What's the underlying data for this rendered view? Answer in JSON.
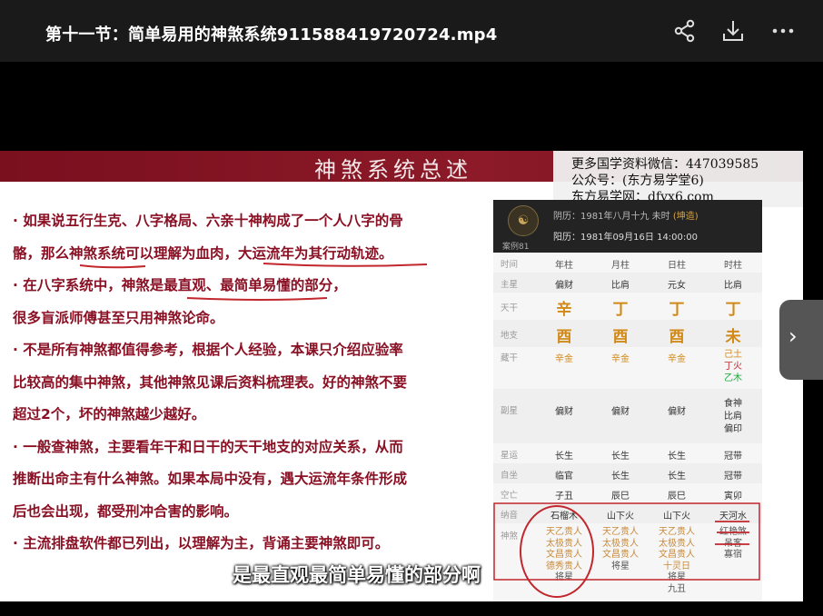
{
  "window": {
    "title": "第十一节：简单易用的神煞系统911588419720724.mp4",
    "icons": [
      "share-icon",
      "download-icon",
      "more-icon"
    ]
  },
  "slide": {
    "banner_title": "神煞系统总述",
    "watermark": {
      "line1": "更多国学资料微信：447039585",
      "line2": "公众号：(东方易学堂6)",
      "line3": "东方易学网：dfyx6.com"
    },
    "bullets": [
      "· 如果说五行生克、八字格局、六亲十神构成了一个人八字的骨",
      "骼，那么神煞系统可以理解为血肉，大运流年为其行动轨迹。",
      "· 在八字系统中，神煞是最直观、最简单易懂的部分，",
      "很多盲派师傅甚至只用神煞论命。",
      "· 不是所有神煞都值得参考，根据个人经验，本课只介绍应验率",
      "比较高的集中神煞，其他神煞见课后资料梳理表。好的神煞不要",
      "超过2个，坏的神煞越少越好。",
      "· 一般查神煞，主要看年干和日干的天干地支的对应关系，从而",
      "推断出命主有什么神煞。如果本局中没有，遇大运流年条件形成",
      "后也会出现，都受刑冲合害的影响。",
      "· 主流排盘软件都已列出，以理解为主，背诵主要神煞即可。"
    ]
  },
  "chart": {
    "avatar_glyph": "☯",
    "case_label": "案例81",
    "yin_date": "阴历：1981年八月十九 未时",
    "yin_tag": "(坤造)",
    "yang_date": "阳历：1981年09月16日 14:00:00",
    "headers": [
      "时间",
      "年柱",
      "月柱",
      "日柱",
      "时柱"
    ],
    "zhuxing": {
      "label": "主星",
      "values": [
        "偏财",
        "比肩",
        "元女",
        "比肩"
      ]
    },
    "tiangan": {
      "label": "天干",
      "values": [
        "辛",
        "丁",
        "丁",
        "丁"
      ]
    },
    "dizhi": {
      "label": "地支",
      "values": [
        "酉",
        "酉",
        "酉",
        "未"
      ]
    },
    "canggan": {
      "label": "藏干",
      "values": [
        "辛金",
        "辛金",
        "辛金"
      ],
      "col4": [
        "己土",
        "丁火",
        "乙木"
      ]
    },
    "fuxing": {
      "label": "副星",
      "values": [
        "偏财",
        "偏财",
        "偏财"
      ],
      "col4": [
        "食神",
        "比肩",
        "偏印"
      ]
    },
    "xingyun": {
      "label": "星运",
      "values": [
        "长生",
        "长生",
        "长生",
        "冠带"
      ]
    },
    "zizuo": {
      "label": "自坐",
      "values": [
        "临官",
        "长生",
        "长生",
        "冠带"
      ]
    },
    "kongwang": {
      "label": "空亡",
      "values": [
        "子丑",
        "辰巳",
        "辰巳",
        "寅卯"
      ]
    },
    "nayin": {
      "label": "纳音",
      "values": [
        "石榴木",
        "山下火",
        "山下火",
        "天河水"
      ]
    },
    "shensha": {
      "label": "神煞",
      "col1": [
        "天乙贵人",
        "太极贵人",
        "文昌贵人",
        "德秀贵人",
        "将星"
      ],
      "col2": [
        "天乙贵人",
        "太极贵人",
        "文昌贵人",
        "将星"
      ],
      "col3": [
        "天乙贵人",
        "太极贵人",
        "文昌贵人",
        "十灵日",
        "将星",
        "九丑"
      ],
      "col4": [
        "红艳煞",
        "吊客",
        "寡宿"
      ]
    }
  },
  "caption": "是最直观最简单易懂的部分啊",
  "next_button": "›",
  "colors": {
    "banner": "#7a0f1e",
    "text_red": "#8a1024",
    "gold": "#d18a17",
    "annotation": "#c1272d"
  }
}
